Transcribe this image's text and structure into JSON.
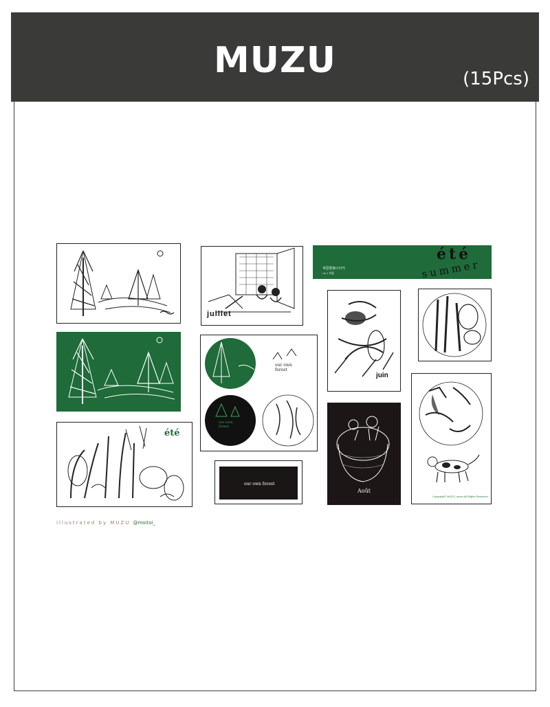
{
  "header": {
    "title": "MUZU",
    "count": "(15Pcs)"
  },
  "cards": {
    "juillet": "juillet",
    "ete_label": "été",
    "summer_label": "summer",
    "banner_korean": "계절季節스티커",
    "banner_vol": "vol.1 여름",
    "ete_small": "été",
    "juin": "juin",
    "forest_text": "our own forest",
    "aout": "Août",
    "copyright": "Copyright© MUZU_muzu All Rights Reserved"
  },
  "credit": {
    "prefix": "illustrated by MUZU",
    "handle": "@moitoi_"
  },
  "colors": {
    "header": "#3a3a38",
    "green": "#1f6b3a",
    "black": "#1c1616"
  }
}
